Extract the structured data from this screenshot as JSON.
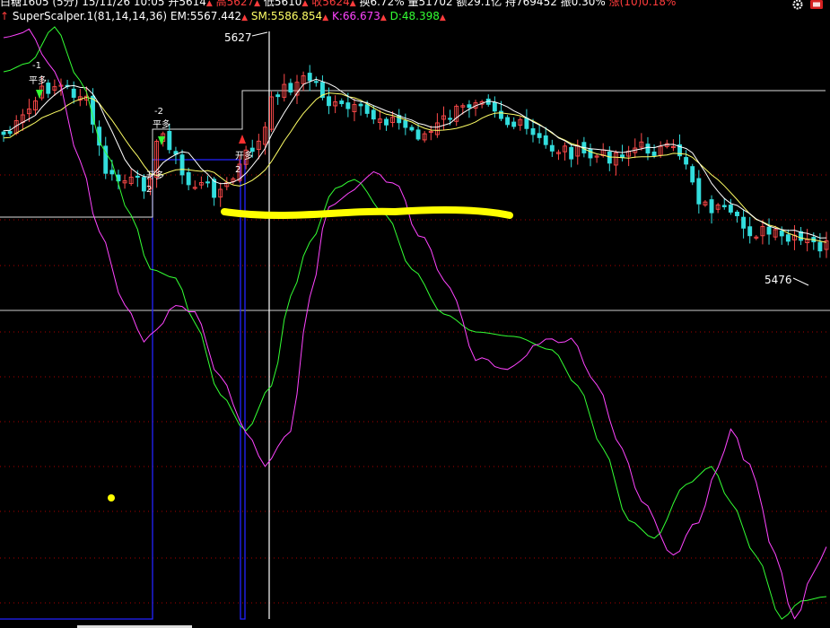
{
  "header": {
    "items": [
      {
        "label": "白糖1605 (5分)",
        "color": "#ffffff"
      },
      {
        "label": "15/11/26 10:05",
        "color": "#ffffff"
      },
      {
        "label": "开5614",
        "color": "#ffffff",
        "arrow": "▲"
      },
      {
        "label": "高5627",
        "color": "#ff3c3c",
        "arrow": "▲"
      },
      {
        "label": "低5610",
        "color": "#ffffff",
        "arrow": "▲"
      },
      {
        "label": "收5624",
        "color": "#ff3c3c",
        "arrow": "▲"
      },
      {
        "label": "换6.72%",
        "color": "#ffffff"
      },
      {
        "label": "量51702",
        "color": "#ffffff"
      },
      {
        "label": "额29.1亿",
        "color": "#ffffff"
      },
      {
        "label": "持769452",
        "color": "#ffffff"
      },
      {
        "label": "振0.30%",
        "color": "#ffffff"
      },
      {
        "label": "涨(10)0.18%",
        "color": "#ff3c3c"
      }
    ]
  },
  "indicator": {
    "name": "SuperScalper.1(81,14,14,36)",
    "values": [
      {
        "label": "EM:5567.442",
        "color": "#ffffff"
      },
      {
        "label": "SM:5586.854",
        "color": "#ffff66"
      },
      {
        "label": "K:66.673",
        "color": "#ff44ff"
      },
      {
        "label": "D:48.398",
        "color": "#33ff33"
      }
    ]
  },
  "icons": [
    "settings-gear-icon",
    "red-toolbar-icon"
  ],
  "chart_data": {
    "type": "candlestick",
    "high_label": "5627",
    "low_label": "5476",
    "price_range": [
      5476,
      5627
    ],
    "markers": [
      {
        "text": "-1",
        "index": 2
      },
      {
        "text": "平多",
        "index": 2
      },
      {
        "text": "-2",
        "index": 25
      },
      {
        "text": "平多",
        "index": 25
      },
      {
        "text": "开多",
        "index": 25
      },
      {
        "text": "2",
        "index": 25
      },
      {
        "text": "开多",
        "index": 38
      },
      {
        "text": "2",
        "index": 38
      }
    ],
    "overlay_colors": {
      "em": "#ffffff",
      "sm": "#ffff66",
      "k": "#ff44ff",
      "d": "#33ff33",
      "position": "#2222ff",
      "highlight": "#ffff00"
    }
  }
}
